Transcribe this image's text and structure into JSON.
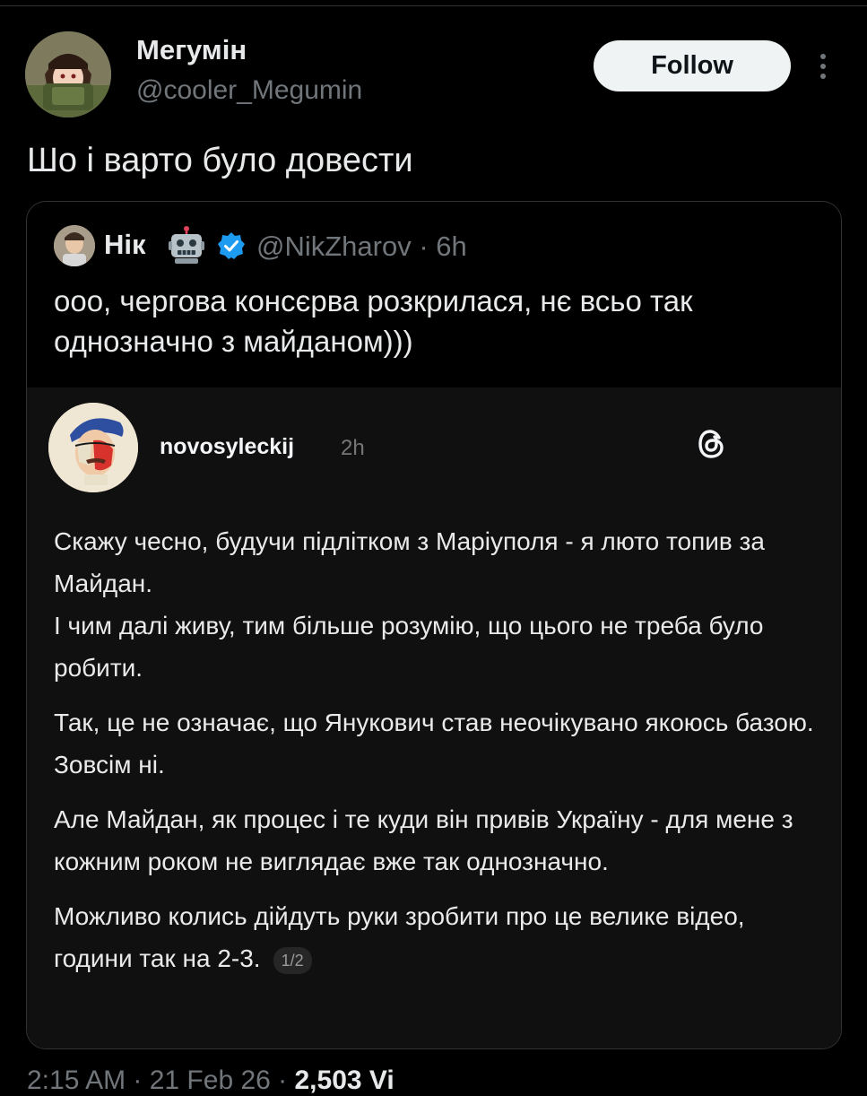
{
  "author": {
    "name": "Мегумін",
    "handle": "@cooler_Megumin"
  },
  "follow_label": "Follow",
  "tweet_text": "Шо і варто було довести",
  "quote": {
    "name": "Нік",
    "handle": "@NikZharov · 6h",
    "text": "ооо, чергова консєрва розкрилася, нє всьо так однозначно з майданом)))",
    "robot_emoji": "🤖",
    "icons": [
      "robot-emoji-icon",
      "verified-badge-icon"
    ]
  },
  "threads_post": {
    "username": "novosyleckij",
    "time": "2h",
    "paragraphs": [
      "Скажу чесно, будучи підлітком з Маріуполя - я люто топив за Майдан.",
      "І чим далі живу, тим більше розумію, що цього не треба було робити.",
      "Так, це не означає, що Янукович став неочікувано якоюсь базою. Зовсім ні.",
      "Але Майдан, як процес і те куди він привів Україну - для мене з кожним роком не виглядає вже так однозначно.",
      "Можливо колись дійдуть руки зробити про це велике відео, години так на 2-3."
    ],
    "pager": "1/2",
    "icons": [
      "threads-logo-icon"
    ]
  },
  "footer": {
    "time_date": "2:15 AM · 21 Feb 26 ·",
    "views": "2,503 Vi"
  },
  "colors": {
    "background": "#000000",
    "text": "#e7e9ea",
    "secondary": "#71767b",
    "verified": "#1d9bf0",
    "embedded_bg": "#101010"
  }
}
